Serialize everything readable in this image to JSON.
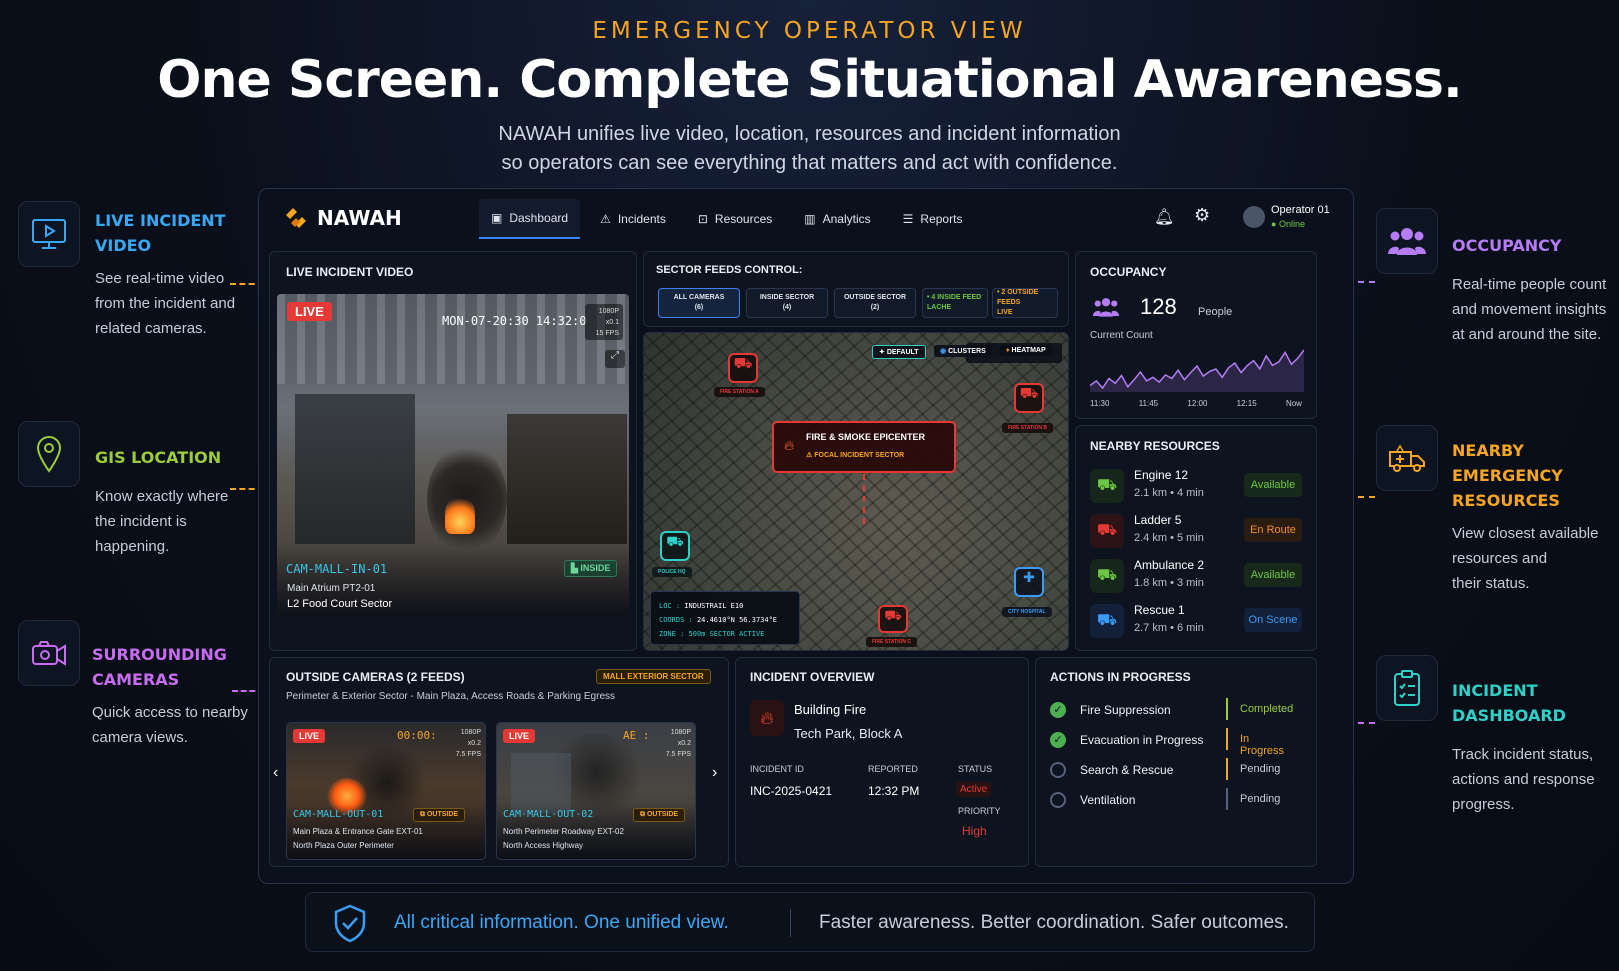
{
  "header": {
    "eyebrow": "EMERGENCY OPERATOR VIEW",
    "headline": "One Screen. Complete Situational Awareness.",
    "subline_1": "NAWAH unifies live video, location, resources and incident information",
    "subline_2": "so operators can see everything that matters and act with confidence."
  },
  "callouts_left": [
    {
      "title_1": "LIVE INCIDENT",
      "title_2": "VIDEO",
      "text_1": "See real-time video",
      "text_2": "from the incident and",
      "text_3": "related cameras.",
      "icon": "monitor-icon",
      "color": "#38a8f5"
    },
    {
      "title_1": "GIS LOCATION",
      "title_2": "",
      "text_1": "Know exactly where",
      "text_2": "the incident is",
      "text_3": "happening.",
      "icon": "map-pin-icon",
      "color": "#9ccc3c"
    },
    {
      "title_1": "SURROUNDING",
      "title_2": "CAMERAS",
      "text_1": "Quick access to nearby",
      "text_2": "camera views.",
      "text_3": "",
      "icon": "camera-icon",
      "color": "#c86cf0"
    }
  ],
  "callouts_right": [
    {
      "title_1": "OCCUPANCY",
      "title_2": "",
      "text_1": "Real-time people count",
      "text_2": "and movement insights",
      "text_3": "at and around the site.",
      "icon": "people-icon",
      "color": "#b57cf5"
    },
    {
      "title_1": "NEARBY EMERGENCY",
      "title_2": "RESOURCES",
      "text_1": "View closest available",
      "text_2": "resources and",
      "text_3": "their status.",
      "icon": "ambulance-icon",
      "color": "#f5a524"
    },
    {
      "title_1": "INCIDENT DASHBOARD",
      "title_2": "",
      "text_1": "Track incident status,",
      "text_2": "actions and response",
      "text_3": "progress.",
      "icon": "clipboard-icon",
      "color": "#2fd0c8"
    }
  ],
  "app": {
    "brand": "NAWAH",
    "nav": [
      "Dashboard",
      "Incidents",
      "Resources",
      "Analytics",
      "Reports"
    ],
    "user_name": "Operator 01",
    "user_status": "Online"
  },
  "live_video": {
    "title": "LIVE INCIDENT VIDEO",
    "live_badge": "LIVE",
    "timestamp": "MON-07-20:30 14:32:0",
    "res": "1080P",
    "zoom": "x0.1",
    "fps": "15 FPS",
    "cam_id": "CAM-MALL-IN-01",
    "inside_tag": "INSIDE",
    "loc_1": "Main Atrium PT2-01",
    "loc_2": "L2 Food Court Sector"
  },
  "sector": {
    "title": "SECTOR FEEDS CONTROL:",
    "chips": [
      {
        "l1": "ALL CAMERAS",
        "l2": "(6)"
      },
      {
        "l1": "INSIDE SECTOR",
        "l2": "(4)"
      },
      {
        "l1": "OUTSIDE SECTOR",
        "l2": "(2)"
      },
      {
        "l1": "• 4 INSIDE FEED",
        "l2": "LACHE"
      },
      {
        "l1": "• 2 OUTSIDE FEEDS",
        "l2": "LIVE"
      }
    ]
  },
  "map": {
    "modes": [
      "DEFAULT",
      "CLUSTERS",
      "HEATMAP"
    ],
    "epicenter_title": "FIRE & SMOKE EPICENTER",
    "epicenter_sub": "FOCAL INCIDENT SECTOR",
    "markers": [
      "FIRE STATION A",
      "FIRE STATION B",
      "POLICE HQ",
      "CITY HOSPITAL",
      "FIRE STATION C"
    ],
    "loc_label": "LOC :",
    "loc_value": "INDUSTRAIL E10",
    "coords_label": "COORDS :",
    "coords_value": "24.4610°N 56.3734°E",
    "zone_label": "ZONE :",
    "zone_value": "500m SECTOR ACTIVE"
  },
  "occupancy": {
    "title": "OCCUPANCY",
    "count": "128",
    "unit": "People",
    "sub": "Current Count",
    "ticks": [
      "11:30",
      "11:45",
      "12:00",
      "12:15",
      "Now"
    ],
    "series": [
      62,
      70,
      58,
      74,
      66,
      79,
      60,
      72,
      85,
      70,
      76,
      68,
      80,
      74,
      88,
      72,
      84,
      95,
      78,
      86,
      90,
      76,
      92,
      100,
      84,
      96,
      104,
      90,
      112,
      96,
      102,
      118,
      98,
      108,
      122
    ]
  },
  "resources": {
    "title": "NEARBY RESOURCES",
    "items": [
      {
        "name": "Engine 12",
        "meta": "2.1 km  •  4 min",
        "status": "Available",
        "color": "#6cc644",
        "icon": "fire-truck-icon"
      },
      {
        "name": "Ladder 5",
        "meta": "2.4 km  •  5 min",
        "status": "En Route",
        "color": "#f28c28",
        "icon": "ladder-truck-icon"
      },
      {
        "name": "Ambulance 2",
        "meta": "1.8 km  •  3 min",
        "status": "Available",
        "color": "#6cc644",
        "icon": "ambulance-icon"
      },
      {
        "name": "Rescue 1",
        "meta": "2.7 km  •  6 min",
        "status": "On Scene",
        "color": "#3b9cf5",
        "icon": "rescue-vehicle-icon"
      }
    ]
  },
  "outside": {
    "title": "OUTSIDE CAMERAS (2 FEEDS)",
    "tag": "MALL EXTERIOR SECTOR",
    "sub": "Perimeter & Exterior Sector - Main Plaza, Access Roads & Parking Egress",
    "cams": [
      {
        "live": "LIVE",
        "time": "00:00:",
        "res": "1080P",
        "zoom": "x0.2",
        "fps": "7.5 FPS",
        "id": "CAM-MALL-OUT-01",
        "tag": "OUTSIDE",
        "l1": "Main Plaza & Entrance Gate EXT-01",
        "l2": "North Plaza Outer Perimeter"
      },
      {
        "live": "LIVE",
        "time": "AE :",
        "res": "1080P",
        "zoom": "x0.2",
        "fps": "7.5 FPS",
        "id": "CAM-MALL-OUT-02",
        "tag": "OUTSIDE",
        "l1": "North Perimeter Roadway EXT-02",
        "l2": "North Access Highway"
      }
    ]
  },
  "overview": {
    "title": "INCIDENT OVERVIEW",
    "type": "Building Fire",
    "place": "Tech Park, Block A",
    "id_label": "INCIDENT ID",
    "id": "INC-2025-0421",
    "reported_label": "REPORTED",
    "reported": "12:32 PM",
    "status_label": "STATUS",
    "status": "Active",
    "priority_label": "PRIORITY",
    "priority": "High"
  },
  "actions": {
    "title": "ACTIONS IN PROGRESS",
    "items": [
      {
        "label": "Fire Suppression",
        "status": "Completed",
        "done": true,
        "color": "#9ccc3c"
      },
      {
        "label": "Evacuation in Progress",
        "status": "In Progress",
        "done": true,
        "color": "#f5a524"
      },
      {
        "label": "Search & Rescue",
        "status": "Pending",
        "done": false,
        "color": "#f5a524"
      },
      {
        "label": "Ventilation",
        "status": "Pending",
        "done": false,
        "color": "#56607a"
      }
    ]
  },
  "footer": {
    "left": "All critical information. One unified view.",
    "right": "Faster awareness. Better coordination. Safer outcomes."
  }
}
